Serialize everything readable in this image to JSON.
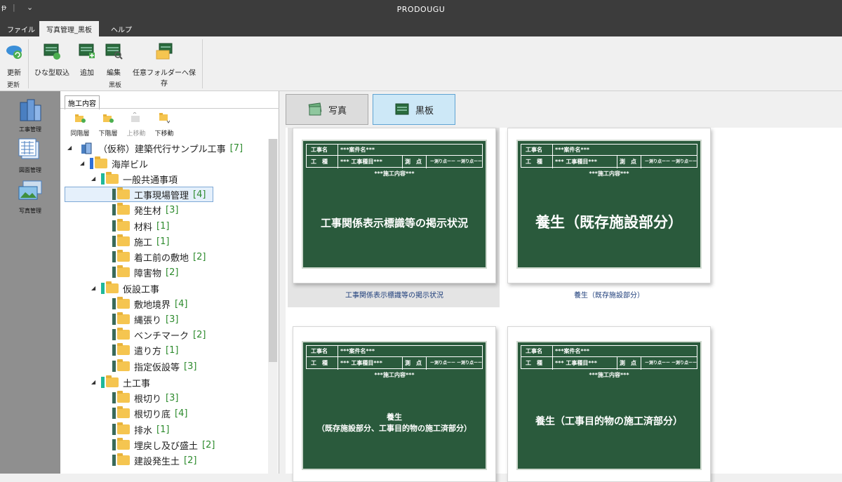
{
  "window": {
    "title": "PRODOUGU"
  },
  "menu": {
    "tabs": [
      "ファイル",
      "写真管理_黒板",
      "ヘルプ"
    ]
  },
  "ribbon": {
    "refresh_label": "更新",
    "template_import_label": "ひな型取込",
    "add_label": "追加",
    "edit_label": "編集",
    "save_folder_label": "任意フォルダーへ保存",
    "group_update": "更新",
    "group_board": "黒板"
  },
  "leftnav": {
    "items": [
      "工事管理",
      "図面管理",
      "写真管理"
    ]
  },
  "tree_panel": {
    "tab_label": "施工内容",
    "toolbar": {
      "same_level": "同階層",
      "lower_level": "下階層",
      "move_up": "上移動",
      "move_down": "下移動"
    },
    "rows": [
      {
        "label": "（仮称）建築代行サンプル工事",
        "count": "[7]"
      },
      {
        "label": "海岸ビル",
        "count": ""
      },
      {
        "label": "一般共通事項",
        "count": ""
      },
      {
        "label": "工事現場管理",
        "count": "[4]"
      },
      {
        "label": "発生材",
        "count": "[3]"
      },
      {
        "label": "材料",
        "count": "[1]"
      },
      {
        "label": "施工",
        "count": "[1]"
      },
      {
        "label": "着工前の敷地",
        "count": "[2]"
      },
      {
        "label": "障害物",
        "count": "[2]"
      },
      {
        "label": "仮設工事",
        "count": ""
      },
      {
        "label": "敷地境界",
        "count": "[4]"
      },
      {
        "label": "縄張り",
        "count": "[3]"
      },
      {
        "label": "ベンチマーク",
        "count": "[2]"
      },
      {
        "label": "遣り方",
        "count": "[1]"
      },
      {
        "label": "指定仮設等",
        "count": "[3]"
      },
      {
        "label": "土工事",
        "count": ""
      },
      {
        "label": "根切り",
        "count": "[3]"
      },
      {
        "label": "根切り底",
        "count": "[4]"
      },
      {
        "label": "排水",
        "count": "[1]"
      },
      {
        "label": "埋戻し及び盛土",
        "count": "[2]"
      },
      {
        "label": "建設発生土",
        "count": "[2]"
      }
    ]
  },
  "content": {
    "photo_button": "写真",
    "board_button": "黒板",
    "board_header": {
      "project_label": "工事名",
      "project_value": "***案件名***",
      "work_label": "工　種",
      "work_value": "*** 工事種目***",
      "survey_label": "測　点",
      "survey_value1": "ー測り点ーー",
      "survey_value2": "ー測り点ーー",
      "content_value": "***施工内容***"
    },
    "cards": [
      {
        "board_title": "工事関係表示標識等の掲示状況",
        "caption": "工事関係表示標識等の掲示状況"
      },
      {
        "board_title": "養生（既存施設部分）",
        "caption": "養生（既存施設部分）"
      },
      {
        "board_title_line1": "養生",
        "board_title_line2": "（既存施設部分、工事目的物の施工済部分）"
      },
      {
        "board_title": "養生（工事目的物の施工済部分）"
      }
    ]
  }
}
